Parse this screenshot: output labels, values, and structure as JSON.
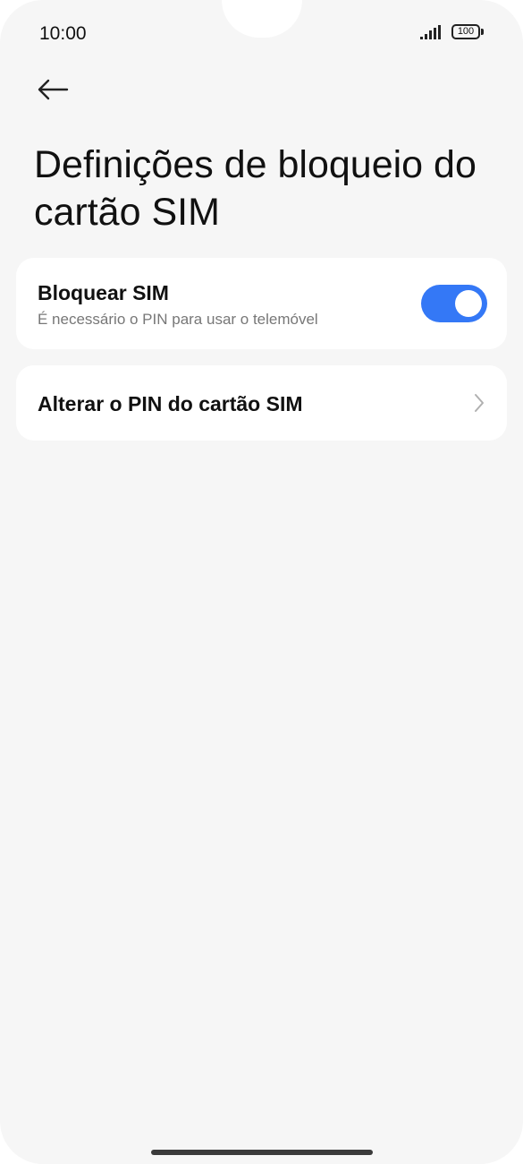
{
  "status_bar": {
    "time": "10:00",
    "battery": "100",
    "signal_icon": "signal-bars-icon",
    "battery_icon": "battery-icon"
  },
  "nav": {
    "back_icon": "arrow-left-icon"
  },
  "page": {
    "title": "Definições de bloqueio do cartão SIM"
  },
  "settings": {
    "sim_lock": {
      "title": "Bloquear SIM",
      "subtitle": "É necessário o PIN para usar o telemóvel",
      "enabled": true
    },
    "change_pin": {
      "title": "Alterar o PIN do cartão SIM",
      "icon": "chevron-right-icon"
    }
  },
  "colors": {
    "accent": "#3478f6",
    "background": "#f6f6f6",
    "card": "#ffffff",
    "text_primary": "#111111",
    "text_secondary": "#777777"
  }
}
